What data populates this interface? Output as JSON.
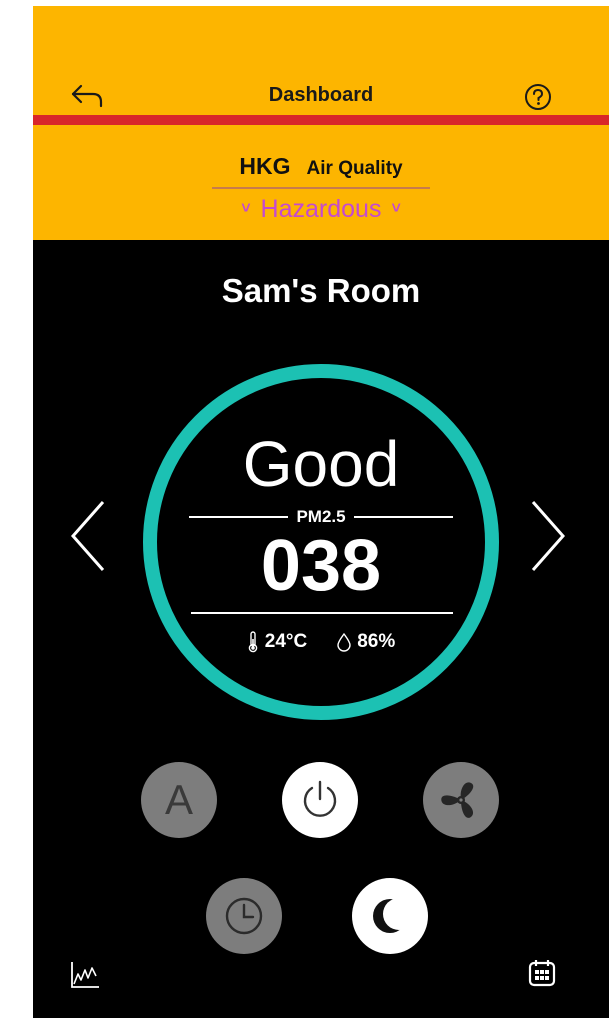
{
  "header": {
    "title": "Dashboard",
    "back_icon": "back-arrow-icon",
    "help_icon": "question-circle-icon",
    "background_color": "#FDB500",
    "rule_color": "#D8262A"
  },
  "air_quality": {
    "city": "HKG",
    "label": "Air Quality",
    "status": "Hazardous",
    "status_color": "#C54AD0",
    "prev_chevron": "˅",
    "next_chevron": "˅"
  },
  "room": {
    "name": "Sam's Room",
    "quality": "Good",
    "metric_label": "PM2.5",
    "metric_value": "038",
    "temperature": "24°C",
    "humidity": "86%",
    "gauge_color": "#1CC1B3"
  },
  "controls": {
    "auto_label": "A",
    "items": [
      "auto-mode",
      "power",
      "fan-speed",
      "timer",
      "sleep-mode"
    ]
  },
  "footer": {
    "left_icon": "chart-icon",
    "right_icon": "calendar-icon"
  }
}
